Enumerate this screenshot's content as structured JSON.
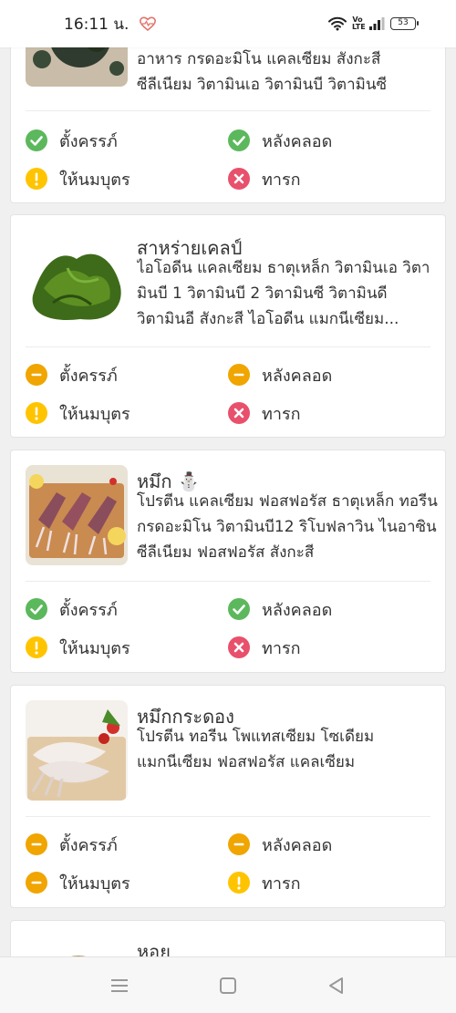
{
  "status_bar": {
    "time": "16:11 น.",
    "volte": "Vo LTE",
    "battery": "53"
  },
  "colors": {
    "ok": "#5cb85c",
    "caution": "#f0a500",
    "warning": "#ffc400",
    "avoid": "#e8506b"
  },
  "foods": [
    {
      "name": "",
      "description": "อาหาร กรดอะมิโน แคลเซียม สังกะสี ซีลีเนียม วิตามินเอ วิตามินบี วิตามินซี",
      "image": "dried-seaweed-photo",
      "statuses": [
        {
          "label": "ตั้งครรภ์",
          "icon": "check-icon",
          "level": "ok"
        },
        {
          "label": "หลังคลอด",
          "icon": "check-icon",
          "level": "ok"
        },
        {
          "label": "ให้นมบุตร",
          "icon": "exclamation-icon",
          "level": "warning"
        },
        {
          "label": "ทารก",
          "icon": "cross-icon",
          "level": "avoid"
        }
      ]
    },
    {
      "name": "สาหร่ายเคลป์",
      "description": "ไอโอดีน แคลเซียม ธาตุเหล็ก วิตามินเอ วิตามินบี 1 วิตามินบี 2 วิตามินซี วิตามินดี วิตามินอี สังกะสี ไอโอดีน แมกนีเซียม...",
      "image": "kelp-photo",
      "statuses": [
        {
          "label": "ตั้งครรภ์",
          "icon": "minus-icon",
          "level": "caution"
        },
        {
          "label": "หลังคลอด",
          "icon": "minus-icon",
          "level": "caution"
        },
        {
          "label": "ให้นมบุตร",
          "icon": "exclamation-icon",
          "level": "warning"
        },
        {
          "label": "ทารก",
          "icon": "cross-icon",
          "level": "avoid"
        }
      ]
    },
    {
      "name": "หมึก ⛄",
      "description": "โปรตีน แคลเซียม ฟอสฟอรัส ธาตุเหล็ก ทอรีน กรดอะมิโน วิตามินบี12 ริโบฟลาวิน ไนอาซิน ซีลีเนียม ฟอสฟอรัส สังกะสี",
      "image": "squid-photo",
      "statuses": [
        {
          "label": "ตั้งครรภ์",
          "icon": "check-icon",
          "level": "ok"
        },
        {
          "label": "หลังคลอด",
          "icon": "check-icon",
          "level": "ok"
        },
        {
          "label": "ให้นมบุตร",
          "icon": "exclamation-icon",
          "level": "warning"
        },
        {
          "label": "ทารก",
          "icon": "cross-icon",
          "level": "avoid"
        }
      ]
    },
    {
      "name": "หมึกกระดอง",
      "description": "โปรตีน ทอรีน โพแทสเซียม โซเดียม แมกนีเซียม ฟอสฟอรัส แคลเซียม",
      "image": "cuttlefish-photo",
      "statuses": [
        {
          "label": "ตั้งครรภ์",
          "icon": "minus-icon",
          "level": "caution"
        },
        {
          "label": "หลังคลอด",
          "icon": "minus-icon",
          "level": "caution"
        },
        {
          "label": "ให้นมบุตร",
          "icon": "minus-icon",
          "level": "caution"
        },
        {
          "label": "ทารก",
          "icon": "exclamation-icon",
          "level": "warning"
        }
      ]
    },
    {
      "name": "หอย",
      "description": "",
      "image": "shellfish-photo",
      "statuses": []
    }
  ],
  "nav": {
    "menu": "menu-icon",
    "home": "home-square-icon",
    "back": "back-triangle-icon"
  }
}
